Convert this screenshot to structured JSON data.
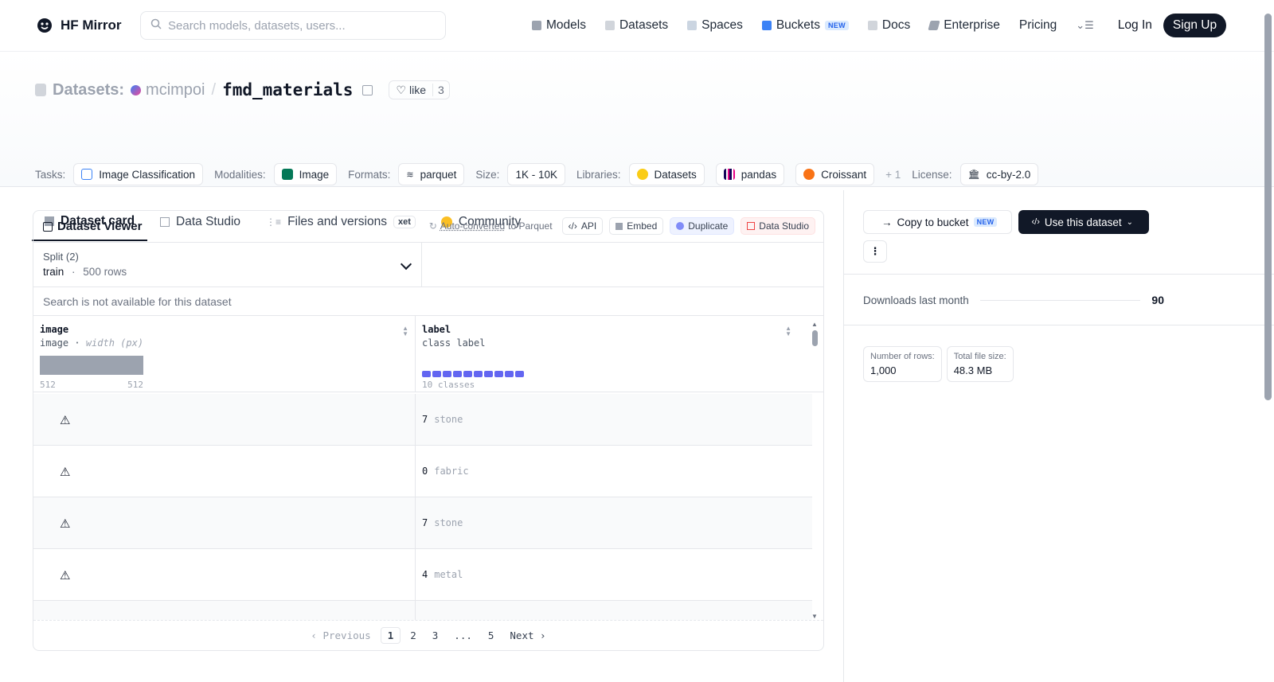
{
  "header": {
    "brand": "HF Mirror",
    "search_placeholder": "Search models, datasets, users...",
    "nav": [
      {
        "label": "Models",
        "icon": "cube-icon"
      },
      {
        "label": "Datasets",
        "icon": "database-icon"
      },
      {
        "label": "Spaces",
        "icon": "grid-icon"
      },
      {
        "label": "Buckets",
        "icon": "bucket-icon",
        "badge": "NEW"
      },
      {
        "label": "Docs",
        "icon": "book-icon"
      },
      {
        "label": "Enterprise",
        "icon": "enterprise-icon"
      },
      {
        "label": "Pricing"
      }
    ],
    "login": "Log In",
    "signup": "Sign Up"
  },
  "title": {
    "prefix": "Datasets:",
    "owner": "mcimpoi",
    "slash": "/",
    "repo": "fmd_materials",
    "like_label": "like",
    "like_count": "3"
  },
  "tags": {
    "tasks_label": "Tasks:",
    "task": "Image Classification",
    "modalities_label": "Modalities:",
    "modality": "Image",
    "formats_label": "Formats:",
    "format": "parquet",
    "size_label": "Size:",
    "size": "1K - 10K",
    "libraries_label": "Libraries:",
    "libraries": [
      "Datasets",
      "pandas",
      "Croissant"
    ],
    "more_libraries": "+ 1",
    "license_label": "License:",
    "license": "cc-by-2.0"
  },
  "tabs": [
    {
      "label": "Dataset card",
      "active": true
    },
    {
      "label": "Data Studio"
    },
    {
      "label": "Files and versions",
      "badge": "xet"
    },
    {
      "label": "Community"
    }
  ],
  "viewer": {
    "title": "Dataset Viewer",
    "auto_converted": "Auto-converted",
    "auto_converted_suffix": "to Parquet",
    "buttons": [
      "API",
      "Embed",
      "Duplicate",
      "Data Studio"
    ],
    "split_label": "Split (2)",
    "split_value": "train",
    "split_sep": "·",
    "split_rows": "500 rows",
    "search_na": "Search is not available for this dataset",
    "columns": [
      {
        "name": "image",
        "type": "image",
        "type_sep": "·",
        "type_extra": "width (px)",
        "min": "512",
        "max": "512"
      },
      {
        "name": "label",
        "type": "class label",
        "summary": "10 classes"
      }
    ],
    "rows": [
      {
        "id": "7",
        "label": "stone"
      },
      {
        "id": "0",
        "label": "fabric"
      },
      {
        "id": "7",
        "label": "stone"
      },
      {
        "id": "4",
        "label": "metal"
      }
    ],
    "pager": {
      "prev": "Previous",
      "pages": [
        "1",
        "2",
        "3",
        "...",
        "5"
      ],
      "next": "Next"
    }
  },
  "sidebar": {
    "copy_bucket": "Copy to bucket",
    "copy_bucket_badge": "NEW",
    "use_dataset": "Use this dataset",
    "downloads_label": "Downloads last month",
    "downloads_value": "90",
    "rows_label": "Number of rows:",
    "rows_value": "1,000",
    "size_label": "Total file size:",
    "size_value": "48.3 MB"
  }
}
